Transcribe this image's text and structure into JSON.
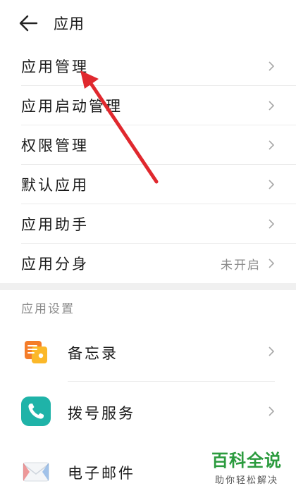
{
  "header": {
    "title": "应用"
  },
  "menu": [
    {
      "label": "应用管理"
    },
    {
      "label": "应用启动管理"
    },
    {
      "label": "权限管理"
    },
    {
      "label": "默认应用"
    },
    {
      "label": "应用助手"
    },
    {
      "label": "应用分身",
      "value": "未开启"
    }
  ],
  "section": {
    "title": "应用设置"
  },
  "apps": [
    {
      "label": "备忘录",
      "icon": "memo-icon"
    },
    {
      "label": "拨号服务",
      "icon": "phone-icon"
    },
    {
      "label": "电子邮件",
      "icon": "mail-icon"
    }
  ],
  "watermark": {
    "brand": "百科全说",
    "tagline": "助你轻松解决"
  },
  "colors": {
    "arrow": "#e0282e",
    "phone_icon": "#1fb3a8",
    "watermark": "#2b9b3e"
  }
}
